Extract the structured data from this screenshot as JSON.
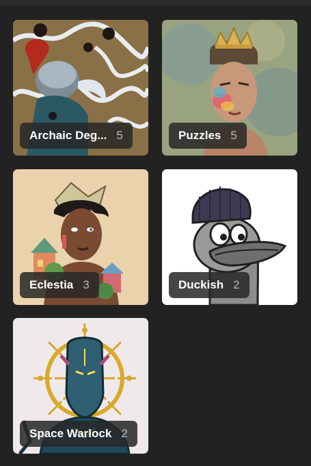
{
  "collections": [
    {
      "title": "Archaic Deg...",
      "count": "5",
      "art": "helmet-creature"
    },
    {
      "title": "Puzzles",
      "count": "5",
      "art": "crowned-man"
    },
    {
      "title": "Eclestia",
      "count": "3",
      "art": "book-crown-figure"
    },
    {
      "title": "Duckish",
      "count": "2",
      "art": "beanie-duck"
    },
    {
      "title": "Space Warlock",
      "count": "2",
      "art": "halo-warlock"
    }
  ],
  "colors": {
    "background": "#222222",
    "label_bg": "#282828",
    "label_text": "#ffffff",
    "count_text": "#b9b9b9"
  }
}
